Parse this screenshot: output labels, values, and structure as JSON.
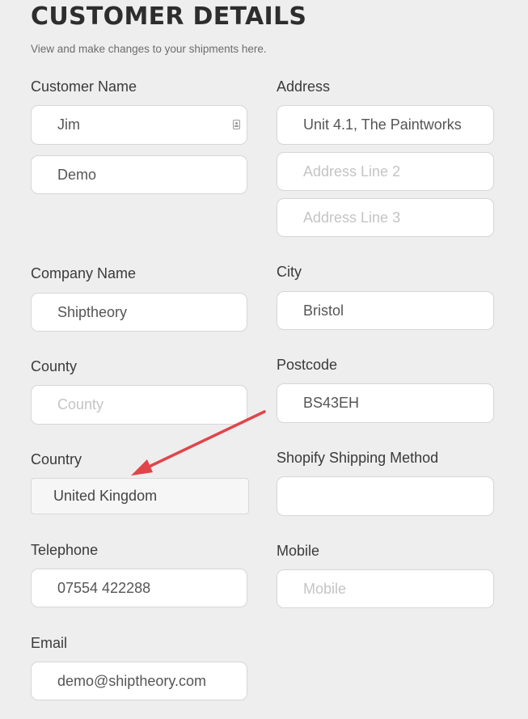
{
  "header": {
    "title": "CUSTOMER DETAILS",
    "subtitle": "View and make changes to your shipments here."
  },
  "customer_name": {
    "label": "Customer Name",
    "first_name": "Jim",
    "last_name": "Demo"
  },
  "address": {
    "label": "Address",
    "line1": "Unit 4.1, The Paintworks",
    "line2_placeholder": "Address Line 2",
    "line3_placeholder": "Address Line 3"
  },
  "company": {
    "label": "Company Name",
    "value": "Shiptheory"
  },
  "city": {
    "label": "City",
    "value": "Bristol"
  },
  "county": {
    "label": "County",
    "placeholder": "County"
  },
  "postcode": {
    "label": "Postcode",
    "value": "BS43EH"
  },
  "country": {
    "label": "Country",
    "value": "United Kingdom"
  },
  "shipping_method": {
    "label": "Shopify Shipping Method",
    "value": ""
  },
  "telephone": {
    "label": "Telephone",
    "value": "07554 422288"
  },
  "mobile": {
    "label": "Mobile",
    "placeholder": "Mobile"
  },
  "email": {
    "label": "Email",
    "value": "demo@shiptheory.com"
  },
  "annotation": {
    "arrow_color": "#e0454a",
    "icon": "contact-card-icon"
  }
}
